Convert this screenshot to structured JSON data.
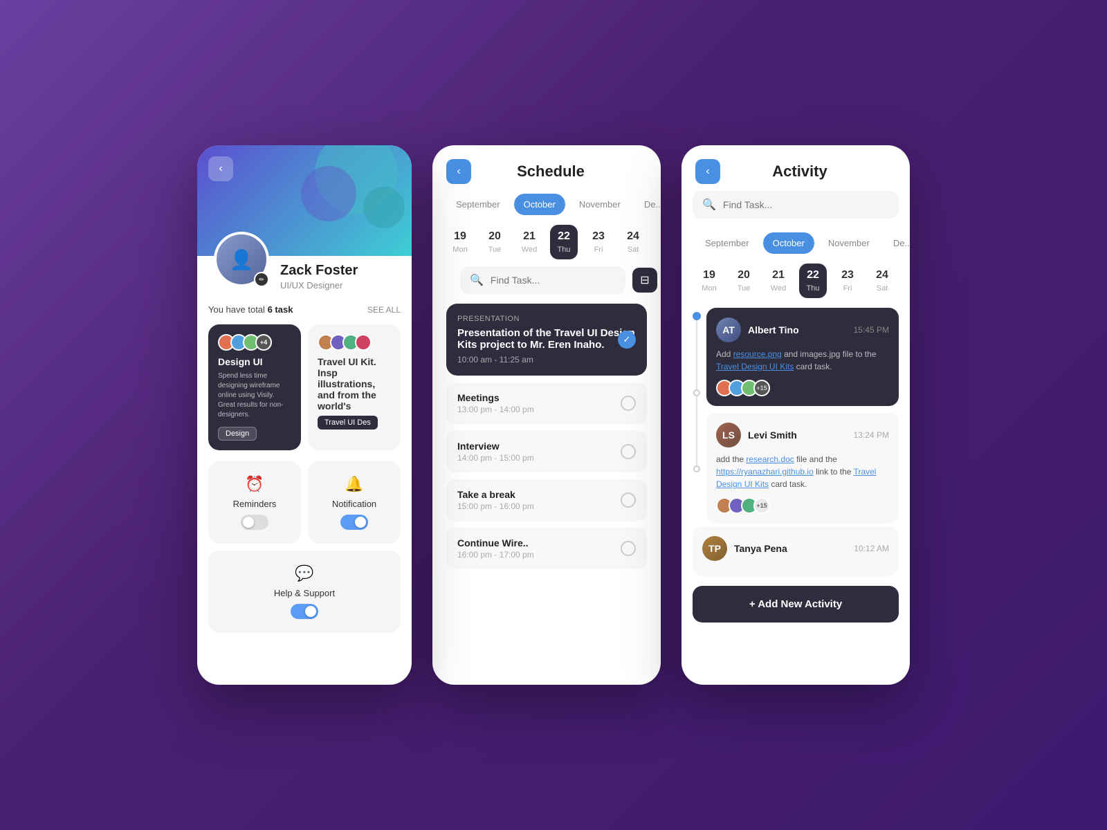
{
  "background": "#5b3d9e",
  "card1": {
    "back_label": "‹",
    "name": "Zack Foster",
    "role": "UI/UX Designer",
    "tasks_text": "You have total",
    "tasks_count": "6 task",
    "see_all": "SEE ALL",
    "task1": {
      "title": "Design UI",
      "description": "Spend less time designing wireframe online using Visily. Great results for non-designers.",
      "tag": "Design",
      "avatar_extra": "+4"
    },
    "task2": {
      "title": "Travel UI Des",
      "description": "Travel UI Kit. Insp illustrations, and from the world's",
      "tag": "Travel UI Des"
    },
    "settings": [
      {
        "label": "Reminders",
        "icon": "⏰",
        "toggle": "off"
      },
      {
        "label": "Notification",
        "icon": "🔔",
        "toggle": "on"
      },
      {
        "label": "Help & Support",
        "icon": "💬",
        "toggle": "on"
      }
    ]
  },
  "card2": {
    "back_label": "‹",
    "title": "Schedule",
    "months": [
      "September",
      "October",
      "November",
      "De"
    ],
    "active_month": "October",
    "days": [
      {
        "num": "19",
        "name": "Mon",
        "active": false
      },
      {
        "num": "20",
        "name": "Tue",
        "active": false
      },
      {
        "num": "21",
        "name": "Wed",
        "active": false
      },
      {
        "num": "22",
        "name": "Thu",
        "active": true
      },
      {
        "num": "23",
        "name": "Fri",
        "active": false
      },
      {
        "num": "24",
        "name": "Sat",
        "active": false
      }
    ],
    "search_placeholder": "Find Task...",
    "filter_icon": "⊟",
    "presentation": {
      "category": "PRESENTATION",
      "title": "Presentation of the Travel UI Design Kits project to Mr. Eren Inaho.",
      "time": "10:00 am - 11:25 am"
    },
    "timeline_items": [
      {
        "title": "Meetings",
        "time": "13:00 pm - 14:00 pm"
      },
      {
        "title": "Interview",
        "time": "14:00 pm - 15:00 pm"
      },
      {
        "title": "Take a break",
        "time": "15:00 pm - 16:00 pm"
      },
      {
        "title": "Continue Wire..",
        "time": "16:00 pm - 17:00 pm"
      }
    ]
  },
  "card3": {
    "back_label": "‹",
    "title": "Activity",
    "search_placeholder": "Find Task...",
    "months": [
      "September",
      "October",
      "November",
      "De"
    ],
    "active_month": "October",
    "days": [
      {
        "num": "19",
        "name": "Mon",
        "active": false
      },
      {
        "num": "20",
        "name": "Tue",
        "active": false
      },
      {
        "num": "21",
        "name": "Wed",
        "active": false
      },
      {
        "num": "22",
        "name": "Thu",
        "active": true
      },
      {
        "num": "23",
        "name": "Fri",
        "active": false
      },
      {
        "num": "24",
        "name": "Sat",
        "active": false
      }
    ],
    "activities": [
      {
        "user": "Albert Tino",
        "time": "15:45 PM",
        "text": "Add resource.png and images.jpg file to the Travel Design UI Kits card task.",
        "avatar_extra": "+15",
        "dark": true
      },
      {
        "user": "Levi Smith",
        "time": "13:24 PM",
        "text": "add the research.doc file and the https://ryanazhari.github.io link to the Travel Design UI Kits card task.",
        "avatar_extra": "+15",
        "dark": false
      }
    ],
    "tanya": {
      "user": "Tanya Pena",
      "time": "10:12 AM"
    },
    "add_btn": "+ Add New Activity"
  }
}
